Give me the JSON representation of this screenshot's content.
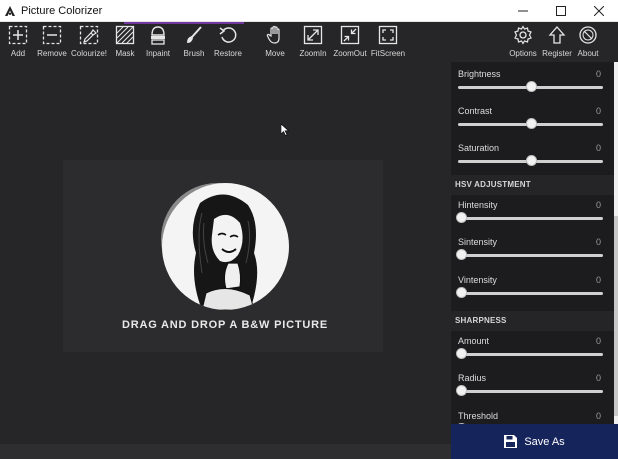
{
  "window": {
    "title": "Picture Colorizer"
  },
  "toolbar": {
    "left_tools": [
      {
        "id": "add",
        "label": "Add",
        "icon": "add-icon"
      },
      {
        "id": "remove",
        "label": "Remove",
        "icon": "remove-icon"
      },
      {
        "id": "colourize",
        "label": "Colourize!",
        "icon": "colourize-icon"
      },
      {
        "id": "mask",
        "label": "Mask",
        "icon": "mask-icon"
      },
      {
        "id": "inpaint",
        "label": "Inpaint",
        "icon": "inpaint-icon"
      },
      {
        "id": "brush",
        "label": "Brush",
        "icon": "brush-icon"
      },
      {
        "id": "restore",
        "label": "Restore",
        "icon": "restore-icon"
      },
      {
        "id": "move",
        "label": "Move",
        "icon": "move-hand-icon"
      },
      {
        "id": "zoomin",
        "label": "ZoomIn",
        "icon": "zoom-in-icon"
      },
      {
        "id": "zoomout",
        "label": "ZoomOut",
        "icon": "zoom-out-icon"
      },
      {
        "id": "fitscreen",
        "label": "FitScreen",
        "icon": "fit-screen-icon"
      }
    ],
    "right_tools": [
      {
        "id": "options",
        "label": "Options",
        "icon": "gear-icon"
      },
      {
        "id": "register",
        "label": "Register",
        "icon": "register-icon"
      },
      {
        "id": "about",
        "label": "About",
        "icon": "about-icon"
      }
    ]
  },
  "canvas": {
    "drop_text": "DRAG AND DROP A B&W PICTURE"
  },
  "panel": {
    "basic": [
      {
        "label": "Brightness",
        "value": "0",
        "position": 0.5
      },
      {
        "label": "Contrast",
        "value": "0",
        "position": 0.5
      },
      {
        "label": "Saturation",
        "value": "0",
        "position": 0.5
      }
    ],
    "hsv_title": "HSV ADJUSTMENT",
    "hsv": [
      {
        "label": "Hintensity",
        "value": "0",
        "position": 0
      },
      {
        "label": "Sintensity",
        "value": "0",
        "position": 0
      },
      {
        "label": "Vintensity",
        "value": "0",
        "position": 0
      }
    ],
    "sharpness_title": "SHARPNESS",
    "sharpness": [
      {
        "label": "Amount",
        "value": "0",
        "position": 0
      },
      {
        "label": "Radius",
        "value": "0",
        "position": 0
      },
      {
        "label": "Threshold",
        "value": "0",
        "position": 0
      }
    ]
  },
  "save_button": {
    "label": "Save As",
    "icon": "floppy-disk-icon"
  },
  "colors": {
    "background": "#262628",
    "panel": "#1c1c1e",
    "accent": "#16245c"
  }
}
